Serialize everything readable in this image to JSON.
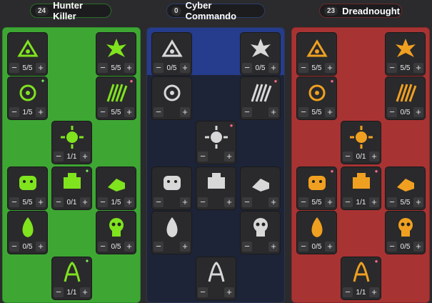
{
  "trees": [
    {
      "key": "green",
      "points": "24",
      "name": "Hunter Killer",
      "nodes": [
        {
          "name": "node-mech-jump",
          "value": "5/5",
          "icon": "jet-icon",
          "badge": ""
        },
        {
          "name": "node-burst",
          "value": "5/5",
          "icon": "burst-icon",
          "badge": ""
        },
        {
          "name": "node-biohazard",
          "value": "1/5",
          "icon": "biohazard-icon",
          "badge": "g"
        },
        {
          "name": "node-claws",
          "value": "5/5",
          "icon": "claw-icon",
          "badge": "r"
        },
        {
          "name": "node-splat",
          "value": "1/1",
          "icon": "splat-icon",
          "badge": ""
        },
        {
          "name": "node-beast",
          "value": "5/5",
          "icon": "beast-icon",
          "badge": ""
        },
        {
          "name": "node-turret",
          "value": "0/1",
          "icon": "turret-icon",
          "badge": "g"
        },
        {
          "name": "node-ammo",
          "value": "1/5",
          "icon": "ammo-icon",
          "badge": ""
        },
        {
          "name": "node-drop",
          "value": "0/5",
          "icon": "drop-icon",
          "badge": ""
        },
        {
          "name": "node-skull",
          "value": "0/5",
          "icon": "skull-icon",
          "badge": ""
        },
        {
          "name": "node-tendrils",
          "value": "1/1",
          "icon": "tendril-icon",
          "badge": "g"
        }
      ]
    },
    {
      "key": "blue",
      "points": "0",
      "name": "Cyber Commando",
      "nodes": [
        {
          "name": "node-warning",
          "value": "0/5",
          "icon": "warning-icon",
          "badge": ""
        },
        {
          "name": "node-cyber-head",
          "value": "0/5",
          "icon": "cyborg-head-icon",
          "badge": ""
        },
        {
          "name": "node-guitar",
          "value": "",
          "icon": "guitar-icon",
          "badge": ""
        },
        {
          "name": "node-robot-arm",
          "value": "",
          "icon": "robot-arm-icon",
          "badge": "r"
        },
        {
          "name": "node-hand",
          "value": "",
          "icon": "hand-icon",
          "badge": "r"
        },
        {
          "name": "node-shield-strike",
          "value": "",
          "icon": "shield-strike-icon",
          "badge": ""
        },
        {
          "name": "node-runner",
          "value": "",
          "icon": "runner-icon",
          "badge": ""
        },
        {
          "name": "node-heart",
          "value": "",
          "icon": "heart-icon",
          "badge": ""
        },
        {
          "name": "node-crawler",
          "value": "",
          "icon": "crawler-icon",
          "badge": ""
        },
        {
          "name": "node-blaster",
          "value": "",
          "icon": "blaster-icon",
          "badge": ""
        },
        {
          "name": "node-arm-cannon",
          "value": "",
          "icon": "arm-cannon-icon",
          "badge": ""
        }
      ]
    },
    {
      "key": "red",
      "points": "23",
      "name": "Dreadnought",
      "nodes": [
        {
          "name": "node-canister",
          "value": "5/5",
          "icon": "canister-icon",
          "badge": ""
        },
        {
          "name": "node-castle",
          "value": "5/5",
          "icon": "castle-icon",
          "badge": ""
        },
        {
          "name": "node-armor",
          "value": "5/5",
          "icon": "armor-icon",
          "badge": "r"
        },
        {
          "name": "node-round-shield",
          "value": "0/5",
          "icon": "round-shield-icon",
          "badge": ""
        },
        {
          "name": "node-radiation",
          "value": "0/1",
          "icon": "radiation-icon",
          "badge": ""
        },
        {
          "name": "node-helmet",
          "value": "5/5",
          "icon": "helmet-icon",
          "badge": "r"
        },
        {
          "name": "node-ammo-belt",
          "value": "1/1",
          "icon": "ammo-belt-icon",
          "badge": "r"
        },
        {
          "name": "node-gasmask",
          "value": "5/5",
          "icon": "gasmask-icon",
          "badge": ""
        },
        {
          "name": "node-bomb",
          "value": "0/5",
          "icon": "bomb-icon",
          "badge": ""
        },
        {
          "name": "node-bug",
          "value": "0/5",
          "icon": "bug-icon",
          "badge": ""
        },
        {
          "name": "node-drill",
          "value": "1/1",
          "icon": "drill-icon",
          "badge": "r"
        }
      ]
    }
  ],
  "colors": {
    "green_icon": "#7fe31e",
    "blue_icon": "#d8d8d8",
    "red_icon": "#f0a020",
    "green_panel": "#3ea734",
    "blue_panel": "#1d2438",
    "red_panel": "#a83333"
  },
  "buttons": {
    "minus": "−",
    "plus": "+"
  }
}
